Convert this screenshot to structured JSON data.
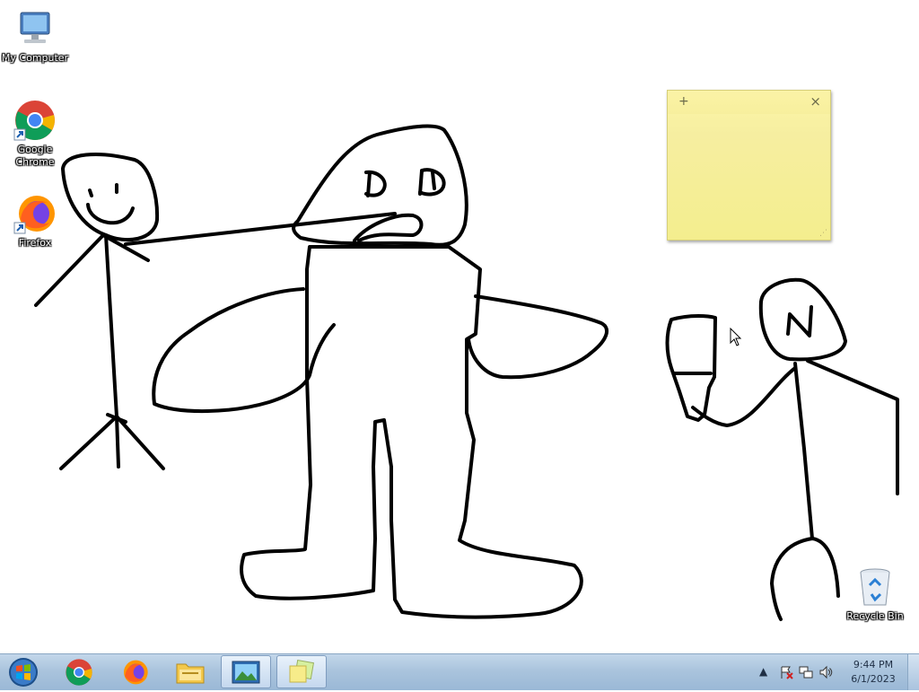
{
  "desktop": {
    "icons": [
      {
        "label": "My Computer",
        "icon": "computer-icon"
      },
      {
        "label": "Google Chrome",
        "icon": "chrome-icon"
      },
      {
        "label": "Firefox",
        "icon": "firefox-icon"
      },
      {
        "label": "Recycle Bin",
        "icon": "recycle-bin-icon"
      }
    ],
    "drawing_text": {
      "big_eyes": "D D",
      "small_face": "N"
    }
  },
  "sticky_note": {
    "add_symbol": "+",
    "close_symbol": "×",
    "content": ""
  },
  "taskbar": {
    "pinned": [
      {
        "name": "start-button",
        "icon": "windows-orb-icon"
      },
      {
        "name": "chrome",
        "icon": "chrome-icon"
      },
      {
        "name": "firefox",
        "icon": "firefox-icon"
      },
      {
        "name": "explorer",
        "icon": "folder-icon"
      },
      {
        "name": "paint",
        "icon": "picture-icon",
        "active": true
      },
      {
        "name": "sticky-notes",
        "icon": "sticky-notes-icon",
        "active": true
      }
    ],
    "tray": {
      "show_hidden": "▲",
      "time": "9:44 PM",
      "date": "6/1/2023"
    }
  },
  "colors": {
    "taskbar": "#aac4dd",
    "sticky": "#f6eea0"
  }
}
